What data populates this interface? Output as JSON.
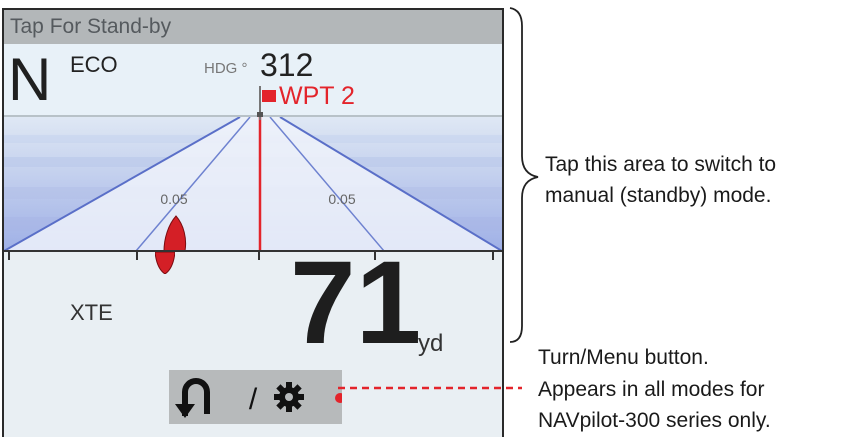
{
  "standby_bar": {
    "label": "Tap For Stand-by"
  },
  "mode": {
    "letter": "N",
    "sub": "ECO"
  },
  "heading": {
    "label": "HDG °",
    "value": "312"
  },
  "waypoint": {
    "label": "WPT 2"
  },
  "highway": {
    "left_scale": "0.05",
    "right_scale": "0.05"
  },
  "xte": {
    "label": "XTE",
    "value": "71",
    "unit": "yd"
  },
  "turn_menu": {
    "label": "/"
  },
  "annotations": {
    "standby_note_line1": "Tap this area to switch to",
    "standby_note_line2": "manual (standby) mode.",
    "button_note_line1": "Turn/Menu button.",
    "button_note_line2": "Appears in all modes for",
    "button_note_line3": "NAVpilot-300 series only."
  },
  "colors": {
    "accent_red": "#e3242b",
    "background": "#e9eff3",
    "annotation_dot": "#e3242b"
  }
}
